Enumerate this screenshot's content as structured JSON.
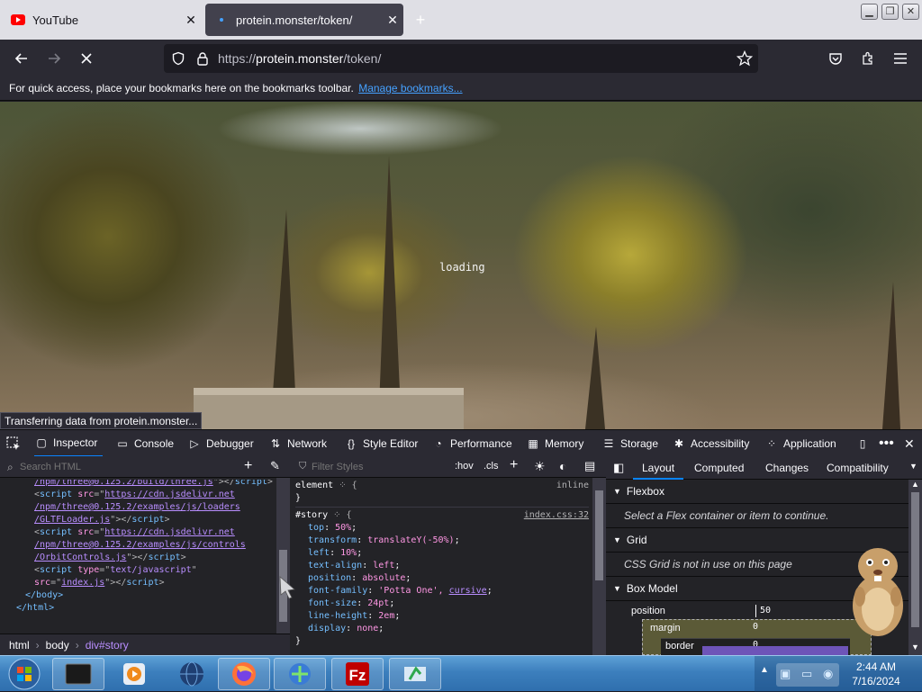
{
  "browser": {
    "tabs": [
      {
        "label": "YouTube",
        "favicon": "youtube-icon"
      },
      {
        "label": "protein.monster/token/",
        "favicon": "loading-dot-icon",
        "active": true
      }
    ],
    "url": {
      "prefix": "https://",
      "host": "protein.monster",
      "path": "/token/"
    },
    "bookmarks": {
      "message": "For quick access, place your bookmarks here on the bookmarks toolbar.",
      "link": "Manage bookmarks..."
    },
    "status": "Transferring data from protein.monster...",
    "page_text": "loading"
  },
  "devtools": {
    "tabs": [
      "Inspector",
      "Console",
      "Debugger",
      "Network",
      "Style Editor",
      "Performance",
      "Memory",
      "Storage",
      "Accessibility",
      "Application"
    ],
    "search_placeholder": "Search HTML",
    "filter_placeholder": "Filter Styles",
    "pseudo": {
      "hov": ":hov",
      "cls": ".cls"
    },
    "html_lines": {
      "l0": "/npm/three@0.125.2/build/three.js",
      "l1_url": "https://cdn.jsdelivr.net",
      "l1b": "/npm/three@0.125.2/examples/js/loaders",
      "l1c": "/GLTFLoader.js",
      "l2_url": "https://cdn.jsdelivr.net",
      "l2b": "/npm/three@0.125.2/examples/js/controls",
      "l2c": "/OrbitControls.js",
      "type_val": "text/javascript",
      "src_val": "index.js",
      "body_close": "</body>",
      "html_close": "</html>"
    },
    "breadcrumbs": [
      "html",
      "body",
      "div#story"
    ],
    "rules": {
      "element_selector": "element",
      "element_source": "inline",
      "story_selector": "#story",
      "story_source": "index.css:32",
      "declarations": [
        {
          "prop": "top",
          "value": "50%"
        },
        {
          "prop": "transform",
          "value": "translateY(-50%)"
        },
        {
          "prop": "left",
          "value": "10%"
        },
        {
          "prop": "text-align",
          "value": "left"
        },
        {
          "prop": "position",
          "value": "absolute"
        },
        {
          "prop": "font-family",
          "value": "'Potta One', ",
          "link": "cursive"
        },
        {
          "prop": "font-size",
          "value": "24pt"
        },
        {
          "prop": "line-height",
          "value": "2em"
        },
        {
          "prop": "display",
          "value": "none"
        }
      ]
    },
    "layout_tabs": [
      "Layout",
      "Computed",
      "Changes",
      "Compatibility"
    ],
    "flexbox": {
      "title": "Flexbox",
      "message": "Select a Flex container or item to continue."
    },
    "grid": {
      "title": "Grid",
      "message": "CSS Grid is not in use on this page"
    },
    "box_model": {
      "title": "Box Model",
      "position_label": "position",
      "position_value": "50",
      "margin_label": "margin",
      "margin_value": "0",
      "border_label": "border",
      "border_value": "0"
    }
  },
  "taskbar": {
    "apps": [
      "media-player-icon",
      "globe-icon",
      "firefox-icon",
      "download-manager-icon",
      "filezilla-icon",
      "sync-icon"
    ],
    "time": "2:44 AM",
    "date": "7/16/2024"
  }
}
